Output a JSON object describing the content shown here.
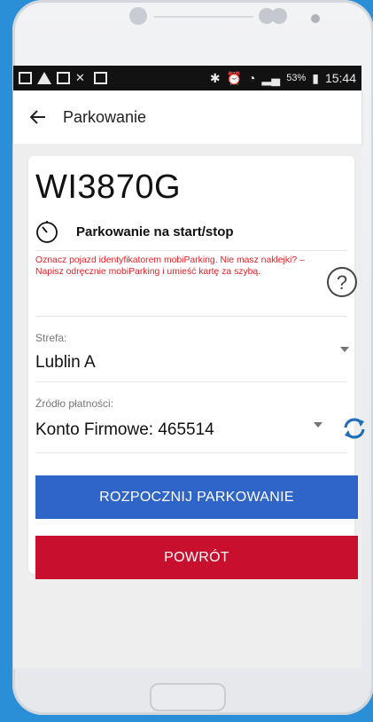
{
  "statusbar": {
    "battery_percent": "53%",
    "time": "15:44"
  },
  "appbar": {
    "title": "Parkowanie"
  },
  "card": {
    "plate": "WI3870G",
    "mode_label": "Parkowanie na start/stop",
    "notice": "Oznacz pojazd identyfikatorem mobiParking. Nie masz naklejki? – Napisz odręcznie mobiParking i umieść kartę za szybą.",
    "zone": {
      "label": "Strefa:",
      "value": "Lublin A"
    },
    "payment": {
      "label": "Źródło płatności:",
      "value": "Konto Firmowe: 465514"
    },
    "start_button": "ROZPOCZNIJ PARKOWANIE",
    "back_button": "POWRÓT"
  },
  "colors": {
    "start_button": "#3065c8",
    "back_button": "#c8102e",
    "notice_text": "#e31e24",
    "refresh_icon": "#1e6fb8"
  }
}
